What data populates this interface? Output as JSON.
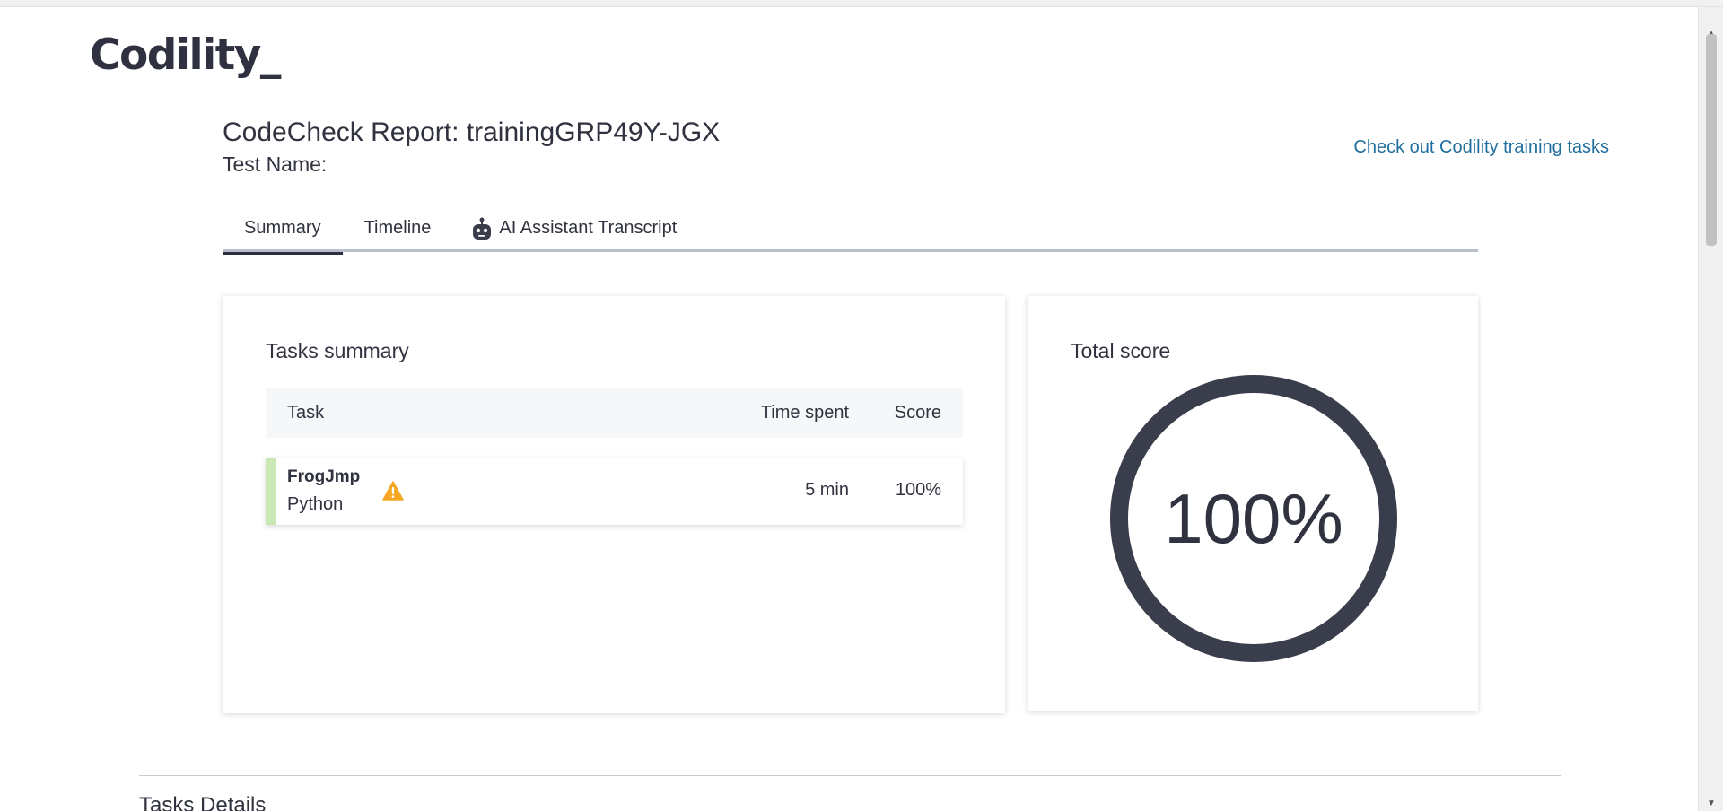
{
  "logo": {
    "text": "Codility_"
  },
  "report": {
    "title": "CodeCheck Report: trainingGRP49Y-JGX",
    "test_name_label": "Test Name:"
  },
  "links": {
    "training": "Check out Codility training tasks"
  },
  "tabs": [
    {
      "label": "Summary",
      "active": true
    },
    {
      "label": "Timeline",
      "active": false
    },
    {
      "label": "AI Assistant Transcript",
      "active": false,
      "icon": "robot-icon"
    }
  ],
  "tasks_summary": {
    "title": "Tasks summary",
    "columns": {
      "task": "Task",
      "time_spent": "Time spent",
      "score": "Score"
    },
    "rows": [
      {
        "name": "FrogJmp",
        "language": "Python",
        "icon": "warning-icon",
        "time": "5 min",
        "score": "100%",
        "status_color": "#c9e8b4"
      }
    ]
  },
  "total_score": {
    "title": "Total score",
    "value": "100%",
    "ring_color": "#3a3d4b"
  },
  "details": {
    "heading": "Tasks Details"
  },
  "colors": {
    "link": "#1f6e9e",
    "text": "#30333f",
    "warning": "#f5a623"
  }
}
